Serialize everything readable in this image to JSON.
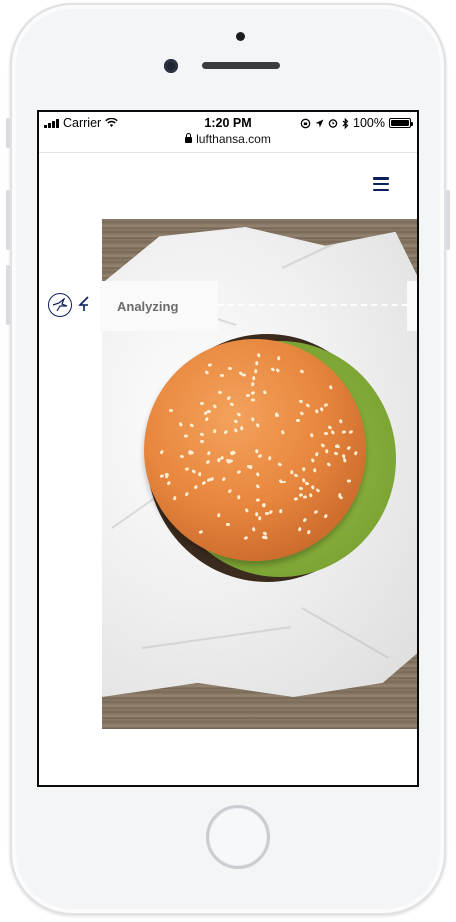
{
  "status_bar": {
    "carrier": "Carrier",
    "time": "1:20 PM",
    "battery": "100%",
    "battery_level": 1.0
  },
  "browser": {
    "url": "lufthansa.com"
  },
  "menu": {
    "icon": "hamburger-menu-icon"
  },
  "image": {
    "description_icon": "burger-photo",
    "status_label": "Analyzing"
  },
  "colors": {
    "brand_navy": "#0a1f5c",
    "label_gray": "#6b6b6b"
  }
}
